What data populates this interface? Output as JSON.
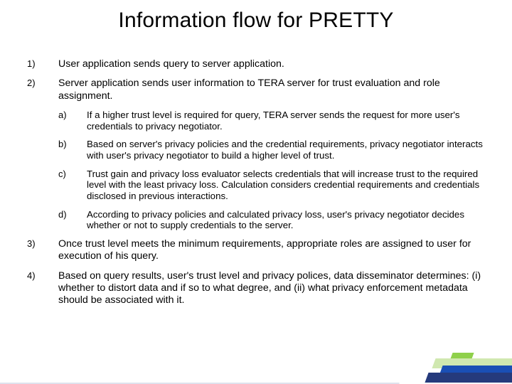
{
  "title": "Information flow for PRETTY",
  "items": [
    {
      "marker": "1)",
      "text": "User application sends query to server application."
    },
    {
      "marker": "2)",
      "text": "Server application sends user information to TERA server for trust evaluation and role assignment.",
      "sub": [
        {
          "marker": "a)",
          "text": "If a higher trust level is required for query, TERA server sends the request for more user's credentials to privacy negotiator."
        },
        {
          "marker": "b)",
          "text": "Based on server's privacy policies and the credential requirements, privacy negotiator interacts with user's privacy negotiator to build a higher level of trust."
        },
        {
          "marker": "c)",
          "text": "Trust gain and privacy loss evaluator selects credentials that will increase trust to the required level with the least privacy loss. Calculation considers credential requirements and credentials disclosed in previous interactions."
        },
        {
          "marker": "d)",
          "text": "According to privacy policies and calculated privacy loss, user's privacy negotiator decides whether or not to supply credentials to the server."
        }
      ]
    },
    {
      "marker": "3)",
      "text": "Once trust level meets the minimum requirements, appropriate roles are assigned to user for execution of his query."
    },
    {
      "marker": "4)",
      "text": "Based on query results, user's trust level and privacy polices, data disseminator determines: (i) whether to distort data and if so to what degree, and (ii) what privacy enforcement metadata should be associated with it."
    }
  ]
}
